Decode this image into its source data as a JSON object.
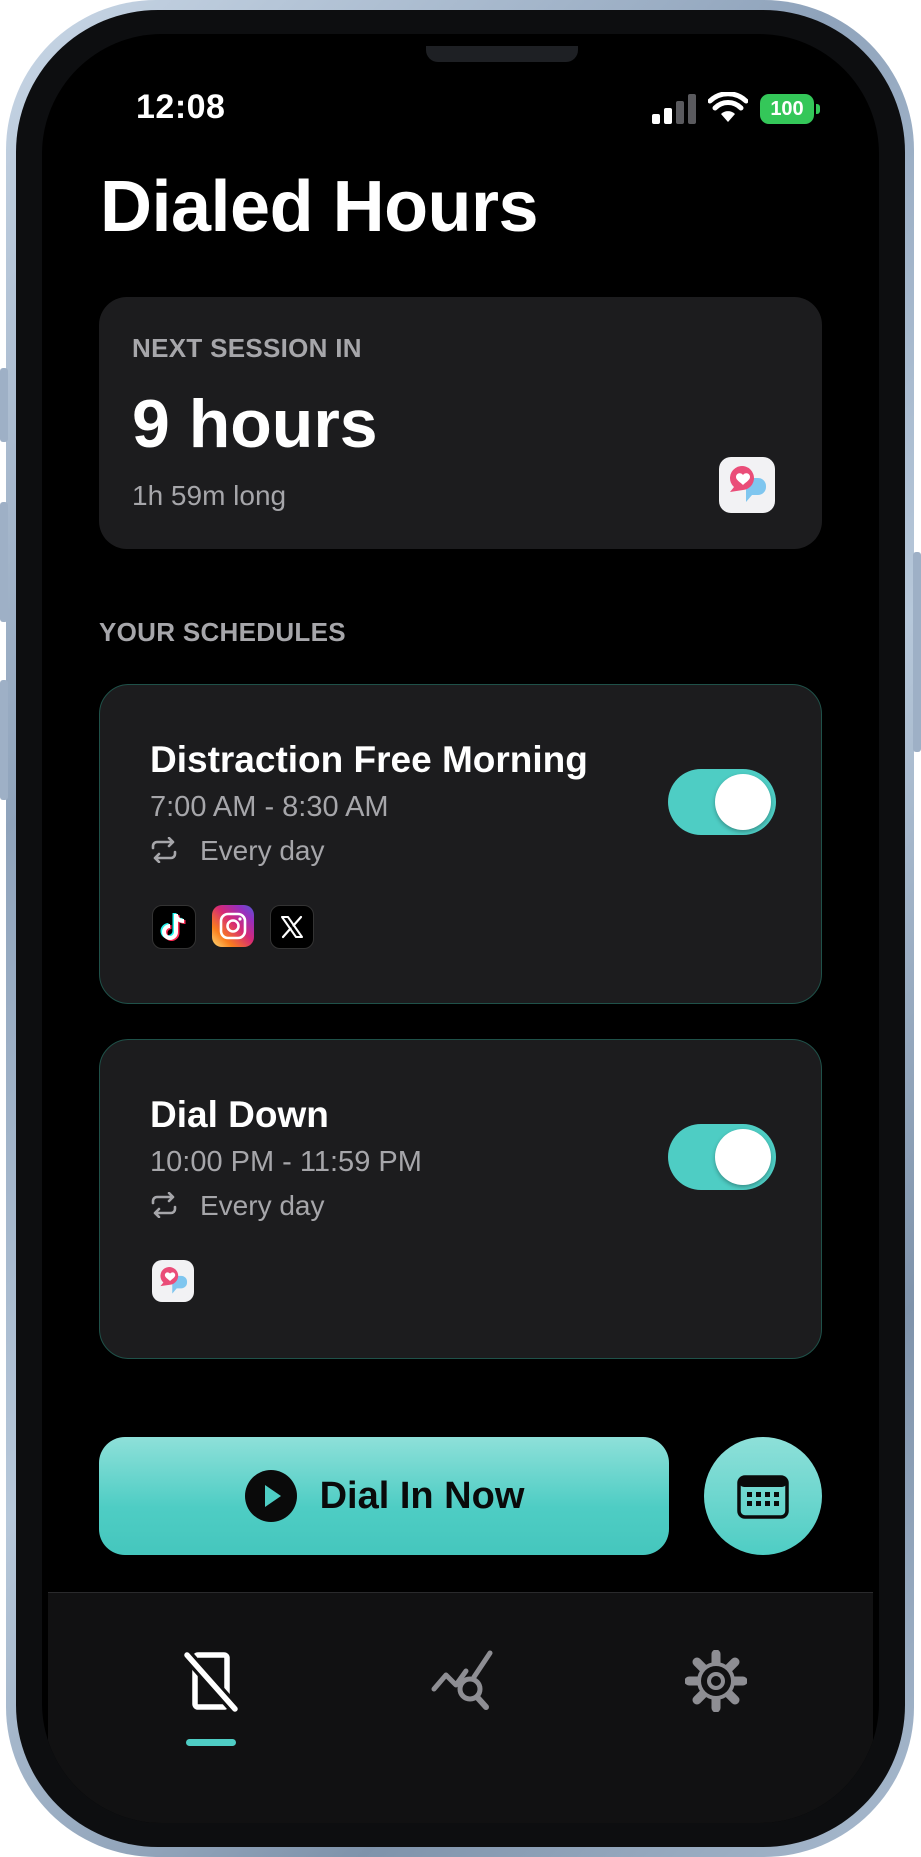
{
  "status_bar": {
    "time": "12:08",
    "battery": "100"
  },
  "app_title": "Dialed Hours",
  "next_session": {
    "label": "NEXT SESSION IN",
    "value": "9 hours",
    "duration": "1h 59m long",
    "app_icon": "chat-heart-app-icon"
  },
  "schedules_label": "YOUR SCHEDULES",
  "schedules": [
    {
      "title": "Distraction Free Morning",
      "time": "7:00 AM - 8:30 AM",
      "repeat": "Every day",
      "enabled": true,
      "apps": [
        "tiktok-icon",
        "instagram-icon",
        "x-icon"
      ]
    },
    {
      "title": "Dial Down",
      "time": "10:00 PM - 11:59 PM",
      "repeat": "Every day",
      "enabled": true,
      "apps": [
        "chat-heart-app-icon"
      ]
    }
  ],
  "actions": {
    "dial_in_label": "Dial In Now",
    "calendar_icon": "calendar-icon"
  },
  "tabs": [
    {
      "icon": "phone-off-icon",
      "active": true
    },
    {
      "icon": "chart-search-icon",
      "active": false
    },
    {
      "icon": "gear-icon",
      "active": false
    }
  ],
  "colors": {
    "accent": "#4ecdc4",
    "background": "#000000",
    "card": "#1c1c1e",
    "muted_text": "#a6a6aa"
  }
}
